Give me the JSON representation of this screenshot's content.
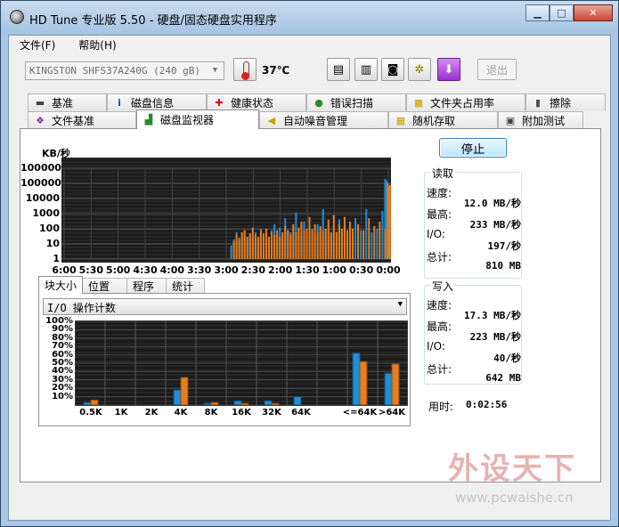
{
  "window": {
    "title": "HD Tune 专业版 5.50 - 硬盘/固态硬盘实用程序",
    "controls": {
      "minimize": "▁",
      "maximize": "□",
      "close": "✕"
    }
  },
  "menu": [
    "文件(F)",
    "帮助(H)"
  ],
  "toolbar": {
    "drive": "KINGSTON SHFS37A240G (240 gB)",
    "temperature": "37℃",
    "exit_label": "退出"
  },
  "tabs_row1": [
    {
      "label": "基准",
      "icon": "benchmark-icon"
    },
    {
      "label": "磁盘信息",
      "icon": "info-icon"
    },
    {
      "label": "健康状态",
      "icon": "health-icon"
    },
    {
      "label": "错误扫描",
      "icon": "scan-icon"
    },
    {
      "label": "文件夹占用率",
      "icon": "folder-icon"
    },
    {
      "label": "擦除",
      "icon": "erase-icon"
    }
  ],
  "tabs_row2": [
    {
      "label": "文件基准",
      "icon": "file-benchmark-icon"
    },
    {
      "label": "磁盘监视器",
      "icon": "monitor-icon",
      "active": true
    },
    {
      "label": "自动噪音管理",
      "icon": "speaker-icon"
    },
    {
      "label": "随机存取",
      "icon": "random-access-icon"
    },
    {
      "label": "附加测试",
      "icon": "extra-tests-icon"
    }
  ],
  "stop_label": "停止",
  "read": {
    "title": "读取",
    "speed_label": "速度:",
    "speed": "12.0 MB/秒",
    "max_label": "最高:",
    "max": "233 MB/秒",
    "io_label": "I/O:",
    "io": "197/秒",
    "total_label": "总计:",
    "total": "810 MB"
  },
  "write": {
    "title": "写入",
    "speed_label": "速度:",
    "speed": "17.3 MB/秒",
    "max_label": "最高:",
    "max": "223 MB/秒",
    "io_label": "I/O:",
    "io": "40/秒",
    "total_label": "总计:",
    "total": "642 MB"
  },
  "elapsed": {
    "label": "用时:",
    "value": "0:02:56"
  },
  "subtabs": [
    "块大小",
    "位置",
    "程序",
    "统计"
  ],
  "io_combo": "I/O 操作计数",
  "colors": {
    "read": "#1e8fd6",
    "write": "#e87c1e",
    "graph_bg": "#1b1b1b",
    "grid": "#4a4a4a"
  },
  "watermark": {
    "cn": "外设天下",
    "url": "www.pcwaishe.cn"
  },
  "chart_data": [
    {
      "type": "bar",
      "ylabel": "KB/秒",
      "y_scale": "log",
      "y_ticks": [
        "1000000",
        "100000",
        "10000",
        "1000",
        "100",
        "10",
        "1"
      ],
      "x_ticks": [
        "6:00",
        "5:30",
        "5:00",
        "4:30",
        "4:00",
        "3:30",
        "3:00",
        "2:30",
        "2:00",
        "1:30",
        "1:00",
        "0:30",
        "0:00"
      ],
      "series": [
        {
          "values": [
            [
              2.9,
              8
            ],
            [
              2.85,
              20
            ],
            [
              2.8,
              60
            ],
            [
              2.75,
              15
            ],
            [
              2.7,
              30
            ],
            [
              2.65,
              80
            ],
            [
              2.6,
              25
            ],
            [
              2.55,
              40
            ],
            [
              2.5,
              10
            ],
            [
              2.45,
              60
            ],
            [
              2.4,
              20
            ],
            [
              2.35,
              100
            ],
            [
              2.3,
              30
            ],
            [
              2.25,
              50
            ],
            [
              2.2,
              15
            ],
            [
              2.15,
              80
            ],
            [
              2.1,
              200
            ],
            [
              2.05,
              40
            ],
            [
              2.0,
              120
            ],
            [
              1.95,
              30
            ],
            [
              1.9,
              500
            ],
            [
              1.85,
              80
            ],
            [
              1.8,
              60
            ],
            [
              1.75,
              150
            ],
            [
              1.7,
              1200
            ],
            [
              1.65,
              60
            ],
            [
              1.6,
              40
            ],
            [
              1.55,
              300
            ],
            [
              1.5,
              80
            ],
            [
              1.45,
              60
            ],
            [
              1.4,
              100
            ],
            [
              1.35,
              40
            ],
            [
              1.3,
              200
            ],
            [
              1.25,
              60
            ],
            [
              1.2,
              2000
            ],
            [
              1.15,
              100
            ],
            [
              1.1,
              80
            ],
            [
              1.05,
              40
            ],
            [
              1.0,
              150
            ],
            [
              0.95,
              60
            ],
            [
              0.9,
              400
            ],
            [
              0.85,
              80
            ],
            [
              0.8,
              100
            ],
            [
              0.75,
              60
            ],
            [
              0.7,
              40
            ],
            [
              0.6,
              500
            ],
            [
              0.5,
              80
            ],
            [
              0.4,
              2000
            ],
            [
              0.3,
              60
            ],
            [
              0.2,
              100
            ],
            [
              0.1,
              1500
            ],
            [
              0.05,
              200000
            ],
            [
              0.03,
              150000
            ],
            [
              0.01,
              120000
            ]
          ]
        },
        {
          "values": [
            [
              2.9,
              15
            ],
            [
              2.85,
              40
            ],
            [
              2.8,
              25
            ],
            [
              2.75,
              60
            ],
            [
              2.7,
              80
            ],
            [
              2.65,
              30
            ],
            [
              2.6,
              50
            ],
            [
              2.55,
              120
            ],
            [
              2.5,
              40
            ],
            [
              2.45,
              30
            ],
            [
              2.4,
              80
            ],
            [
              2.35,
              50
            ],
            [
              2.3,
              100
            ],
            [
              2.25,
              30
            ],
            [
              2.2,
              60
            ],
            [
              2.15,
              40
            ],
            [
              2.1,
              80
            ],
            [
              2.05,
              30
            ],
            [
              2.0,
              60
            ],
            [
              1.95,
              150
            ],
            [
              1.9,
              80
            ],
            [
              1.85,
              40
            ],
            [
              1.8,
              200
            ],
            [
              1.75,
              60
            ],
            [
              1.7,
              120
            ],
            [
              1.65,
              300
            ],
            [
              1.6,
              80
            ],
            [
              1.55,
              100
            ],
            [
              1.5,
              600
            ],
            [
              1.45,
              80
            ],
            [
              1.4,
              200
            ],
            [
              1.35,
              60
            ],
            [
              1.3,
              150
            ],
            [
              1.25,
              80
            ],
            [
              1.2,
              100
            ],
            [
              1.15,
              400
            ],
            [
              1.1,
              60
            ],
            [
              1.05,
              800
            ],
            [
              1.0,
              60
            ],
            [
              0.95,
              200
            ],
            [
              0.9,
              100
            ],
            [
              0.85,
              600
            ],
            [
              0.8,
              80
            ],
            [
              0.75,
              300
            ],
            [
              0.7,
              100
            ],
            [
              0.6,
              200
            ],
            [
              0.5,
              80
            ],
            [
              0.4,
              500
            ],
            [
              0.3,
              150
            ],
            [
              0.2,
              300
            ],
            [
              0.1,
              100
            ],
            [
              0.05,
              100000
            ],
            [
              0.03,
              60000
            ],
            [
              0.01,
              80000
            ]
          ]
        }
      ]
    },
    {
      "type": "bar",
      "y_ticks": [
        "100%",
        "90%",
        "80%",
        "70%",
        "60%",
        "50%",
        "40%",
        "30%",
        "20%",
        "10%"
      ],
      "categories": [
        "0.5K",
        "1K",
        "2K",
        "4K",
        "8K",
        "16K",
        "32K",
        "64K",
        "<=64K",
        ">64K"
      ],
      "series": [
        {
          "values": [
            3,
            0,
            0,
            18,
            2,
            5,
            5,
            10,
            62,
            38
          ]
        },
        {
          "values": [
            6,
            0,
            0,
            33,
            3,
            2,
            2,
            0,
            52,
            49
          ]
        }
      ]
    }
  ]
}
